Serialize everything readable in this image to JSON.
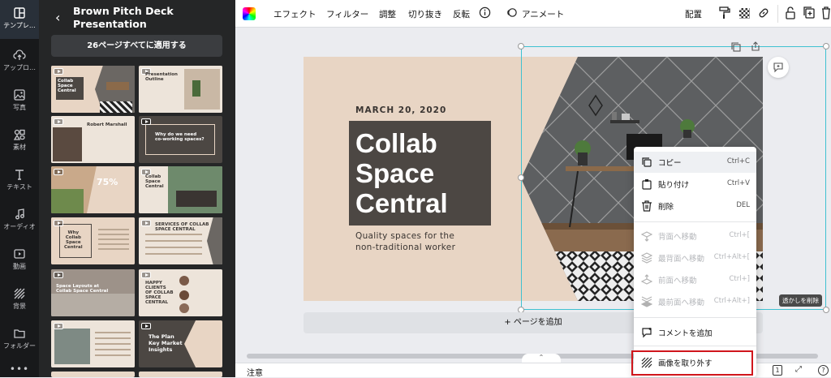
{
  "rail": {
    "items": [
      {
        "label": "テンプレ…",
        "icon": "template-icon"
      },
      {
        "label": "アップロ…",
        "icon": "upload-icon"
      },
      {
        "label": "写真",
        "icon": "photo-icon"
      },
      {
        "label": "素材",
        "icon": "elements-icon"
      },
      {
        "label": "テキスト",
        "icon": "text-icon"
      },
      {
        "label": "オーディオ",
        "icon": "audio-icon"
      },
      {
        "label": "動画",
        "icon": "video-icon"
      },
      {
        "label": "背景",
        "icon": "background-icon"
      },
      {
        "label": "フォルダー",
        "icon": "folder-icon"
      }
    ],
    "more": "•••"
  },
  "panel": {
    "title": "Brown Pitch Deck Presentation",
    "apply_all": "26ページすべてに適用する",
    "thumbs": [
      {
        "text": "Collab\nSpace\nCentral",
        "dark": false
      },
      {
        "text": "Presentation\nOutline",
        "dark": false
      },
      {
        "text": "Robert Marshall",
        "dark": false
      },
      {
        "text": "Why do we need\nco-working spaces?",
        "dark": true
      },
      {
        "text": "75%",
        "dark": false
      },
      {
        "text": "Collab\nSpace\nCentral",
        "dark": false
      },
      {
        "text": "Why\nCollab\nSpace\nCentral",
        "dark": false
      },
      {
        "text": "SERVICES OF COLLAB\nSPACE CENTRAL",
        "dark": false
      },
      {
        "text": "Space Layouts at\nCollab Space Central",
        "dark": false
      },
      {
        "text": "HAPPY\nCLIENTS\nOF COLLAB\nSPACE\nCENTRAL",
        "dark": false
      },
      {
        "text": "",
        "dark": false
      },
      {
        "text": "The Plan\nKey Market\nInsights",
        "dark": true
      }
    ]
  },
  "toolbar": {
    "effect": "エフェクト",
    "filter": "フィルター",
    "adjust": "調整",
    "crop": "切り抜き",
    "flip": "反転",
    "animate": "アニメート",
    "position": "配置"
  },
  "slide": {
    "date": "MARCH 20, 2020",
    "title": "Collab\nSpace\nCentral",
    "subtitle": "Quality spaces for the\nnon-traditional worker",
    "remove_watermark": "透かしを削除"
  },
  "add_page": "+ ページを追加",
  "status": {
    "note": "注意",
    "page_num": "1"
  },
  "context_menu": {
    "items": [
      {
        "label": "コピー",
        "shortcut": "Ctrl+C",
        "icon": "copy-icon",
        "disabled": false
      },
      {
        "label": "貼り付け",
        "shortcut": "Ctrl+V",
        "icon": "paste-icon",
        "disabled": false
      },
      {
        "label": "削除",
        "shortcut": "DEL",
        "icon": "trash-icon",
        "disabled": false
      },
      {
        "label": "背面へ移動",
        "shortcut": "Ctrl+[",
        "icon": "send-backward-icon",
        "disabled": true
      },
      {
        "label": "最背面へ移動",
        "shortcut": "Ctrl+Alt+[",
        "icon": "send-to-back-icon",
        "disabled": true
      },
      {
        "label": "前面へ移動",
        "shortcut": "Ctrl+]",
        "icon": "bring-forward-icon",
        "disabled": true
      },
      {
        "label": "最前面へ移動",
        "shortcut": "Ctrl+Alt+]",
        "icon": "bring-to-front-icon",
        "disabled": true
      },
      {
        "label": "コメントを追加",
        "shortcut": "",
        "icon": "comment-add-icon",
        "disabled": false
      },
      {
        "label": "画像を取り外す",
        "shortcut": "",
        "icon": "detach-image-icon",
        "disabled": false
      }
    ]
  },
  "colors": {
    "accent_selection": "#3fc1d1",
    "highlight": "#d0161c",
    "rail_bg": "#18191b",
    "panel_bg": "#252627",
    "slide_bg": "#e8d5c4",
    "title_box": "#4c4743"
  }
}
